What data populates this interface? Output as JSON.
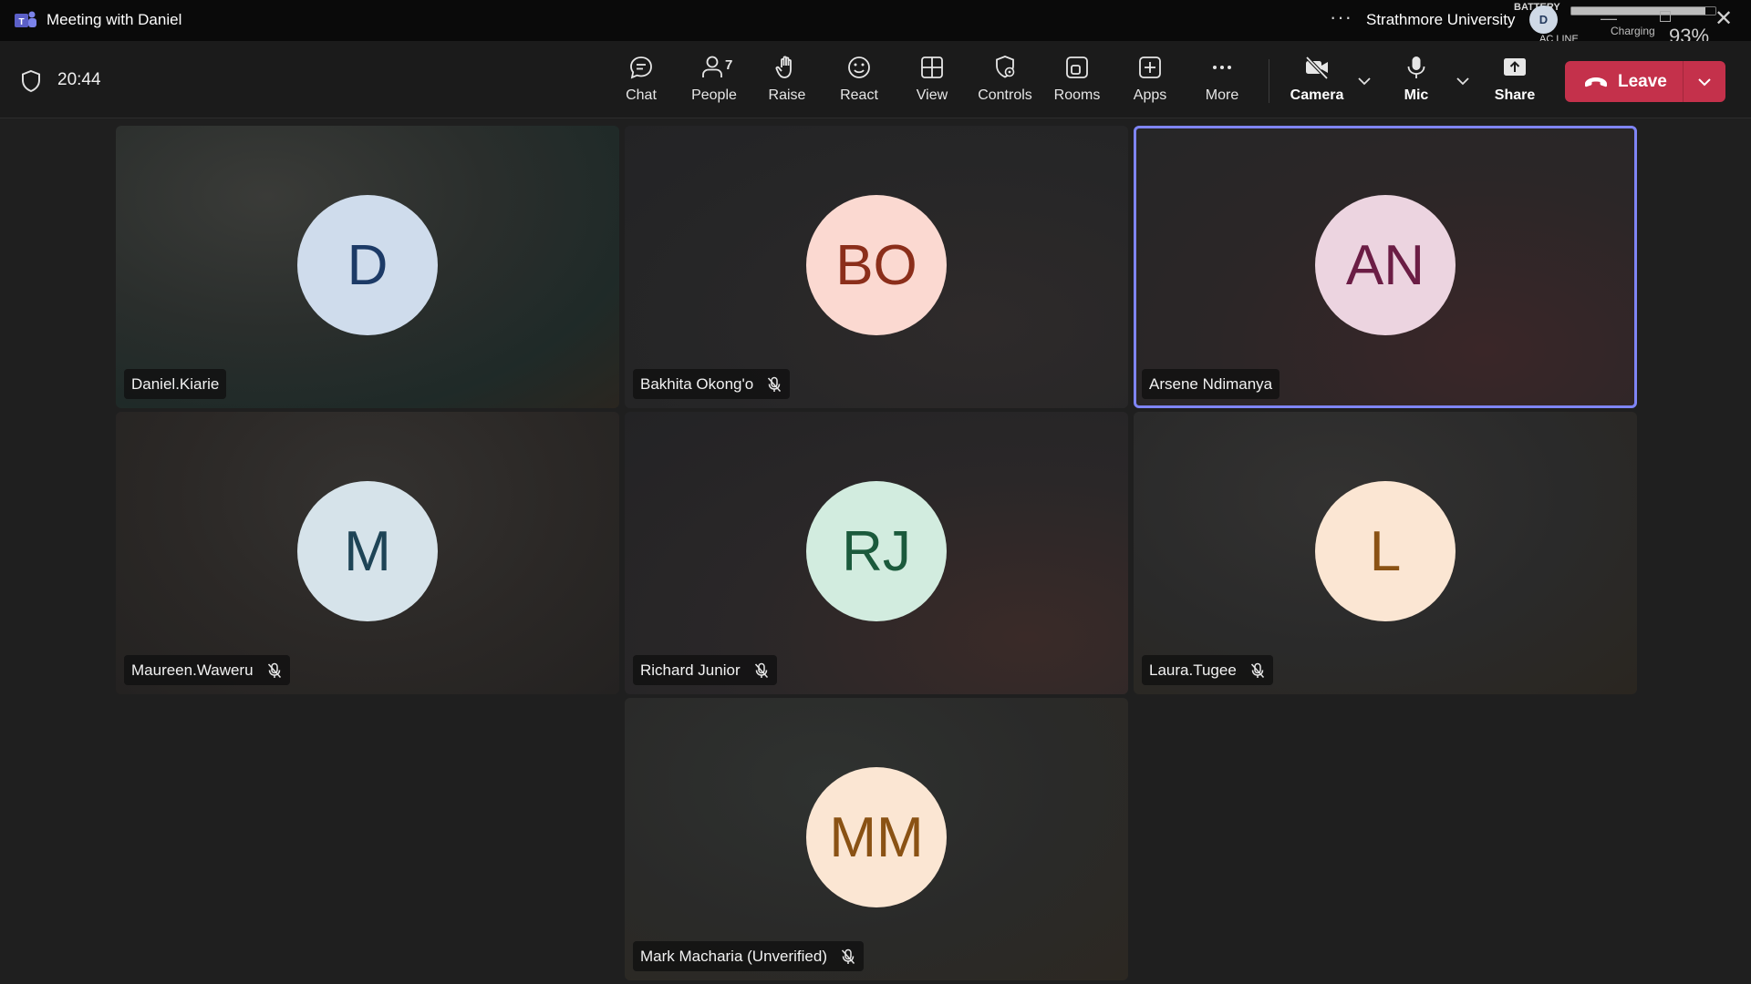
{
  "window": {
    "title": "Meeting with Daniel",
    "more": "···",
    "org": "Strathmore University",
    "account_initial": "D"
  },
  "battery": {
    "label": "BATTERY",
    "ac_line": "AC LINE",
    "charging": "Charging",
    "percent_text": "93%",
    "level": 0.93
  },
  "toolbar": {
    "timer": "20:44",
    "chat": "Chat",
    "people": "People",
    "people_count": "7",
    "raise": "Raise",
    "react": "React",
    "view": "View",
    "controls": "Controls",
    "rooms": "Rooms",
    "apps": "Apps",
    "more": "More",
    "camera": "Camera",
    "mic": "Mic",
    "share": "Share",
    "leave": "Leave"
  },
  "participants": [
    {
      "name": "Daniel.Kiarie",
      "initials": "D",
      "muted": false,
      "active": false,
      "avatar_bg": "#cfdcec",
      "avatar_fg": "#1c3a66"
    },
    {
      "name": "Bakhita Okong'o",
      "initials": "BO",
      "muted": true,
      "active": false,
      "avatar_bg": "#fbd9d1",
      "avatar_fg": "#8b2e1a"
    },
    {
      "name": "Arsene Ndimanya",
      "initials": "AN",
      "muted": false,
      "active": true,
      "avatar_bg": "#ecd4e0",
      "avatar_fg": "#6b1d45"
    },
    {
      "name": "Maureen.Waweru",
      "initials": "M",
      "muted": true,
      "active": false,
      "avatar_bg": "#d6e3ea",
      "avatar_fg": "#1e4456"
    },
    {
      "name": "Richard Junior",
      "initials": "RJ",
      "muted": true,
      "active": false,
      "avatar_bg": "#d2ecdf",
      "avatar_fg": "#1b5a3c"
    },
    {
      "name": "Laura.Tugee",
      "initials": "L",
      "muted": true,
      "active": false,
      "avatar_bg": "#fbe6d3",
      "avatar_fg": "#8a5214"
    },
    {
      "name": "Mark Macharia (Unverified)",
      "initials": "MM",
      "muted": true,
      "active": false,
      "avatar_bg": "#fbe6d3",
      "avatar_fg": "#8a5214"
    }
  ],
  "colors": {
    "leave": "#c4314b",
    "active_border": "#7f85f5"
  }
}
